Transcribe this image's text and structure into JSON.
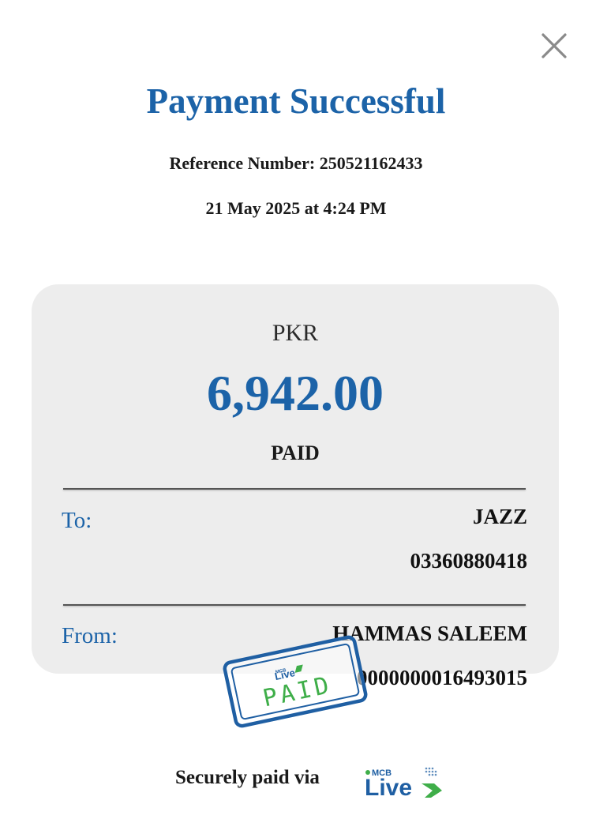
{
  "header": {
    "title": "Payment Successful",
    "reference": "Reference Number: 250521162433",
    "datetime": "21 May 2025 at 4:24 PM",
    "close_icon": "close-icon"
  },
  "receipt": {
    "currency": "PKR",
    "amount": "6,942.00",
    "status": "PAID",
    "to": {
      "label": "To:",
      "name": "JAZZ",
      "account": "03360880418"
    },
    "from": {
      "label": "From:",
      "name": "HAMMAS SALEEM",
      "account": "0000000016493015"
    }
  },
  "stamp": {
    "text": "PAID",
    "logo_text": "Live",
    "logo_brand": "MCB"
  },
  "footer": {
    "text": "Securely paid via",
    "logo_text": "Live",
    "logo_brand": "MCB"
  },
  "colors": {
    "accent": "#1c63a8",
    "card_bg": "#ededed",
    "brand_green": "#3fae49"
  }
}
